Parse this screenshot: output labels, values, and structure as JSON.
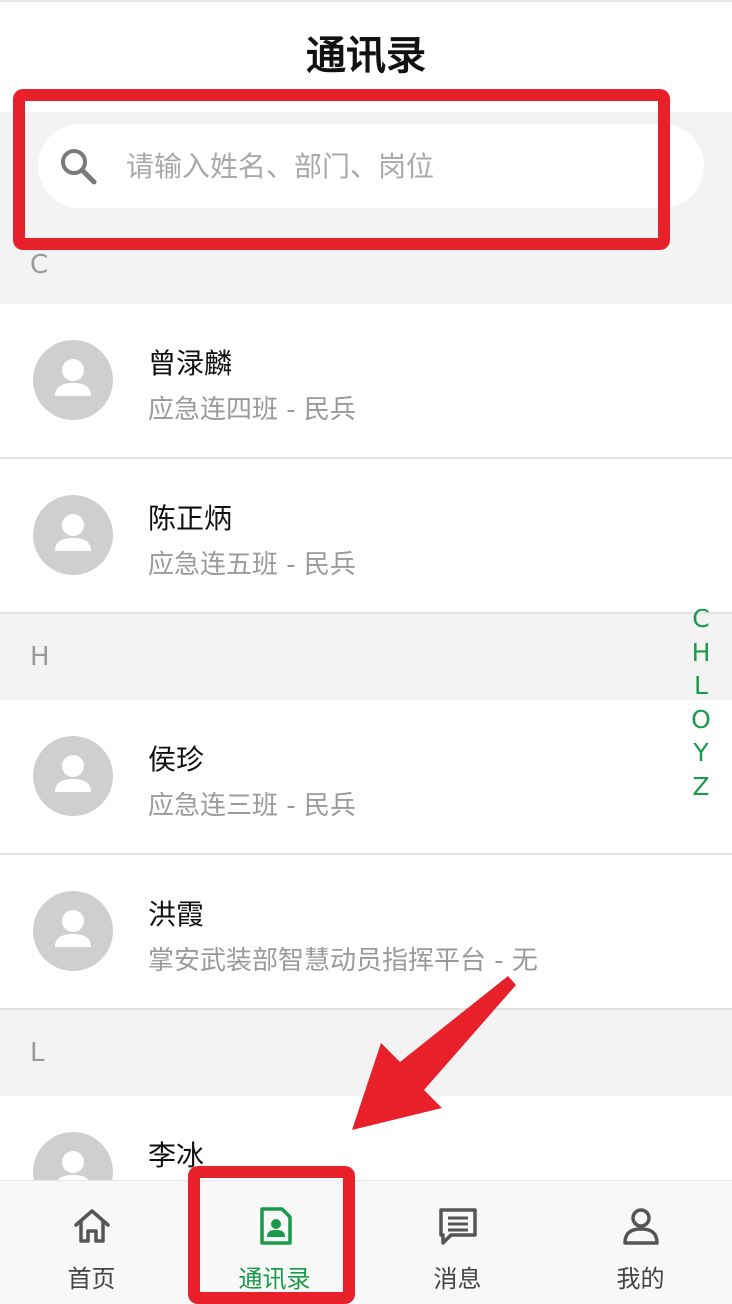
{
  "header": {
    "title": "通讯录"
  },
  "search": {
    "placeholder": "请输入姓名、部门、岗位"
  },
  "sections": [
    {
      "letter": "C",
      "contacts": [
        {
          "name": "曾渌麟",
          "dept": "应急连四班 - 民兵"
        },
        {
          "name": "陈正炳",
          "dept": "应急连五班 - 民兵"
        }
      ]
    },
    {
      "letter": "H",
      "contacts": [
        {
          "name": "侯珍",
          "dept": "应急连三班 - 民兵"
        },
        {
          "name": "洪霞",
          "dept": "掌安武装部智慧动员指挥平台 - 无"
        }
      ]
    },
    {
      "letter": "L",
      "contacts": [
        {
          "name": "李冰",
          "dept": ""
        }
      ]
    }
  ],
  "index_letters": [
    "C",
    "H",
    "L",
    "O",
    "Y",
    "Z"
  ],
  "tabbar": {
    "tabs": [
      {
        "label": "首页",
        "icon": "home-icon",
        "active": false
      },
      {
        "label": "通讯录",
        "icon": "contact-card-icon",
        "active": true
      },
      {
        "label": "消息",
        "icon": "message-icon",
        "active": false
      },
      {
        "label": "我的",
        "icon": "user-icon",
        "active": false
      }
    ]
  },
  "colors": {
    "accent": "#1a9a4b",
    "annotation_red": "#e8202a",
    "section_bg": "#f3f3f3",
    "avatar_bg": "#cfcfcf"
  }
}
